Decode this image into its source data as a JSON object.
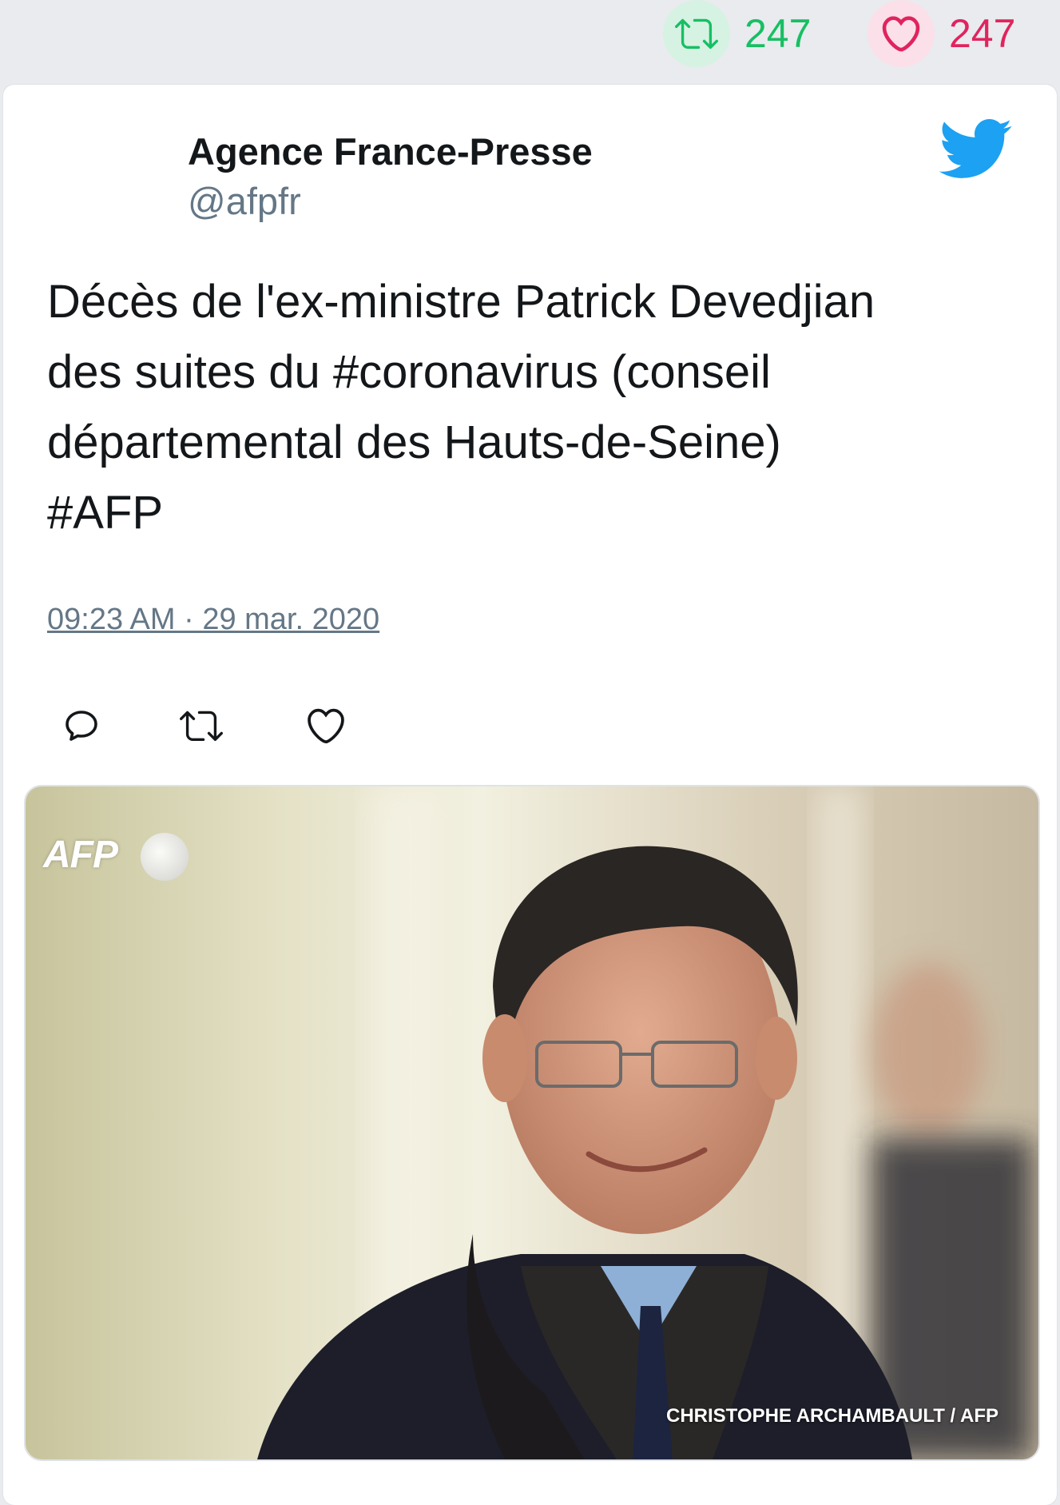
{
  "stats": {
    "retweet_count": "247",
    "like_count": "247"
  },
  "tweet": {
    "author_name": "Agence France-Presse",
    "author_handle": "@afpfr",
    "text": "Décès de l'ex-ministre Patrick Devedjian\ndes suites du #coronavirus (conseil\ndépartemental des Hauts-de-Seine)\n#AFP",
    "timestamp": "09:23 AM · 29 mar. 2020",
    "media": {
      "watermark": "AFP",
      "credit": "CHRISTOPHE ARCHAMBAULT / AFP"
    }
  },
  "icons": {
    "retweet": "retweet-icon",
    "like": "heart-icon",
    "reply": "reply-icon",
    "brand": "twitter-bird-icon"
  },
  "colors": {
    "retweet": "#17bf63",
    "like": "#e0245e",
    "twitter_blue": "#1da1f2",
    "handle_gray": "#657786",
    "text": "#14171a"
  }
}
